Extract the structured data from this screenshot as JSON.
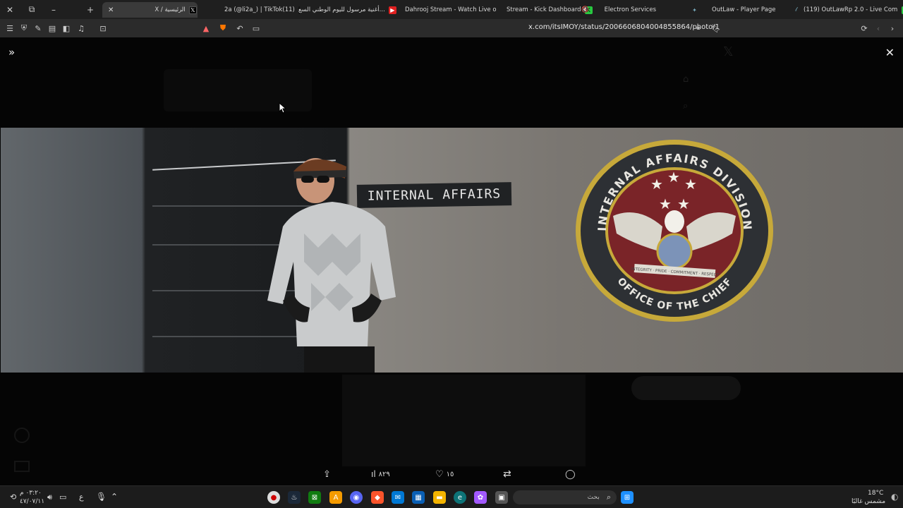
{
  "browser": {
    "tabs": [
      {
        "label": "X / الرئيسية",
        "favicon": "x-icon",
        "active": true
      },
      {
        "label": "2a (@li2a_) | TikTok(11)",
        "favicon": "tiktok-icon"
      },
      {
        "label": "أغنية مرسول لليوم الوطني السع...",
        "favicon": "youtube-icon"
      },
      {
        "label": "Dahrooj Stream - Watch Live o",
        "favicon": "kick-icon"
      },
      {
        "label": "Stream - Kick Dashboard",
        "favicon": "kick-icon"
      },
      {
        "label": "Electron Services",
        "favicon": "electron-icon"
      },
      {
        "label": "OutLaw - Player Page",
        "favicon": "outlaw-icon"
      },
      {
        "label": "(119) OutLawRp 2.0 - Live Com",
        "favicon": "outlaw-icon"
      }
    ],
    "url": "x.com/itsIMOY/status/2006606804004855864/photo/1"
  },
  "photo": {
    "sign_text": "INTERNAL AFFAIRS",
    "seal_top_text": "INTERNAL AFFAIRS DIVISION",
    "seal_bottom_text": "OFFICE OF THE CHIEF",
    "seal_band_text": "INTEGRITY · PRIDE · COMMITMENT · RESPECT"
  },
  "actions": {
    "views": "٨٢٩",
    "likes": "١٥"
  },
  "taskbar": {
    "time": "٠٣:٢٠ م",
    "date": "٤٧/٠٧/١١",
    "lang": "ع",
    "search_placeholder": "بحث",
    "weather_temp": "18°C",
    "weather_desc": "مشمس غالبًا"
  }
}
